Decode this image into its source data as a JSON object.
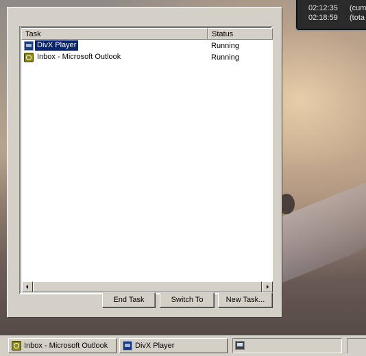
{
  "timer": {
    "rows": [
      {
        "time": "02:12:35",
        "label": "(cum"
      },
      {
        "time": "02:18:59",
        "label": "(tota"
      }
    ]
  },
  "task_list": {
    "columns": [
      "Task",
      "Status"
    ],
    "rows": [
      {
        "name": "DivX Player",
        "status": "Running",
        "icon": "divx-player-icon",
        "selected": true
      },
      {
        "name": "Inbox - Microsoft Outlook",
        "status": "Running",
        "icon": "outlook-icon",
        "selected": false
      }
    ]
  },
  "buttons": {
    "end_task": "End Task",
    "switch_to": "Switch To",
    "new_task": "New Task..."
  },
  "taskbar": {
    "items": [
      {
        "label": "Inbox - Microsoft Outlook",
        "icon": "outlook-icon"
      },
      {
        "label": "DivX Player",
        "icon": "divx-player-icon"
      }
    ],
    "tray_icon": "computer-icon"
  },
  "colors": {
    "selection": "#0a246a",
    "face": "#d4d0c8"
  }
}
